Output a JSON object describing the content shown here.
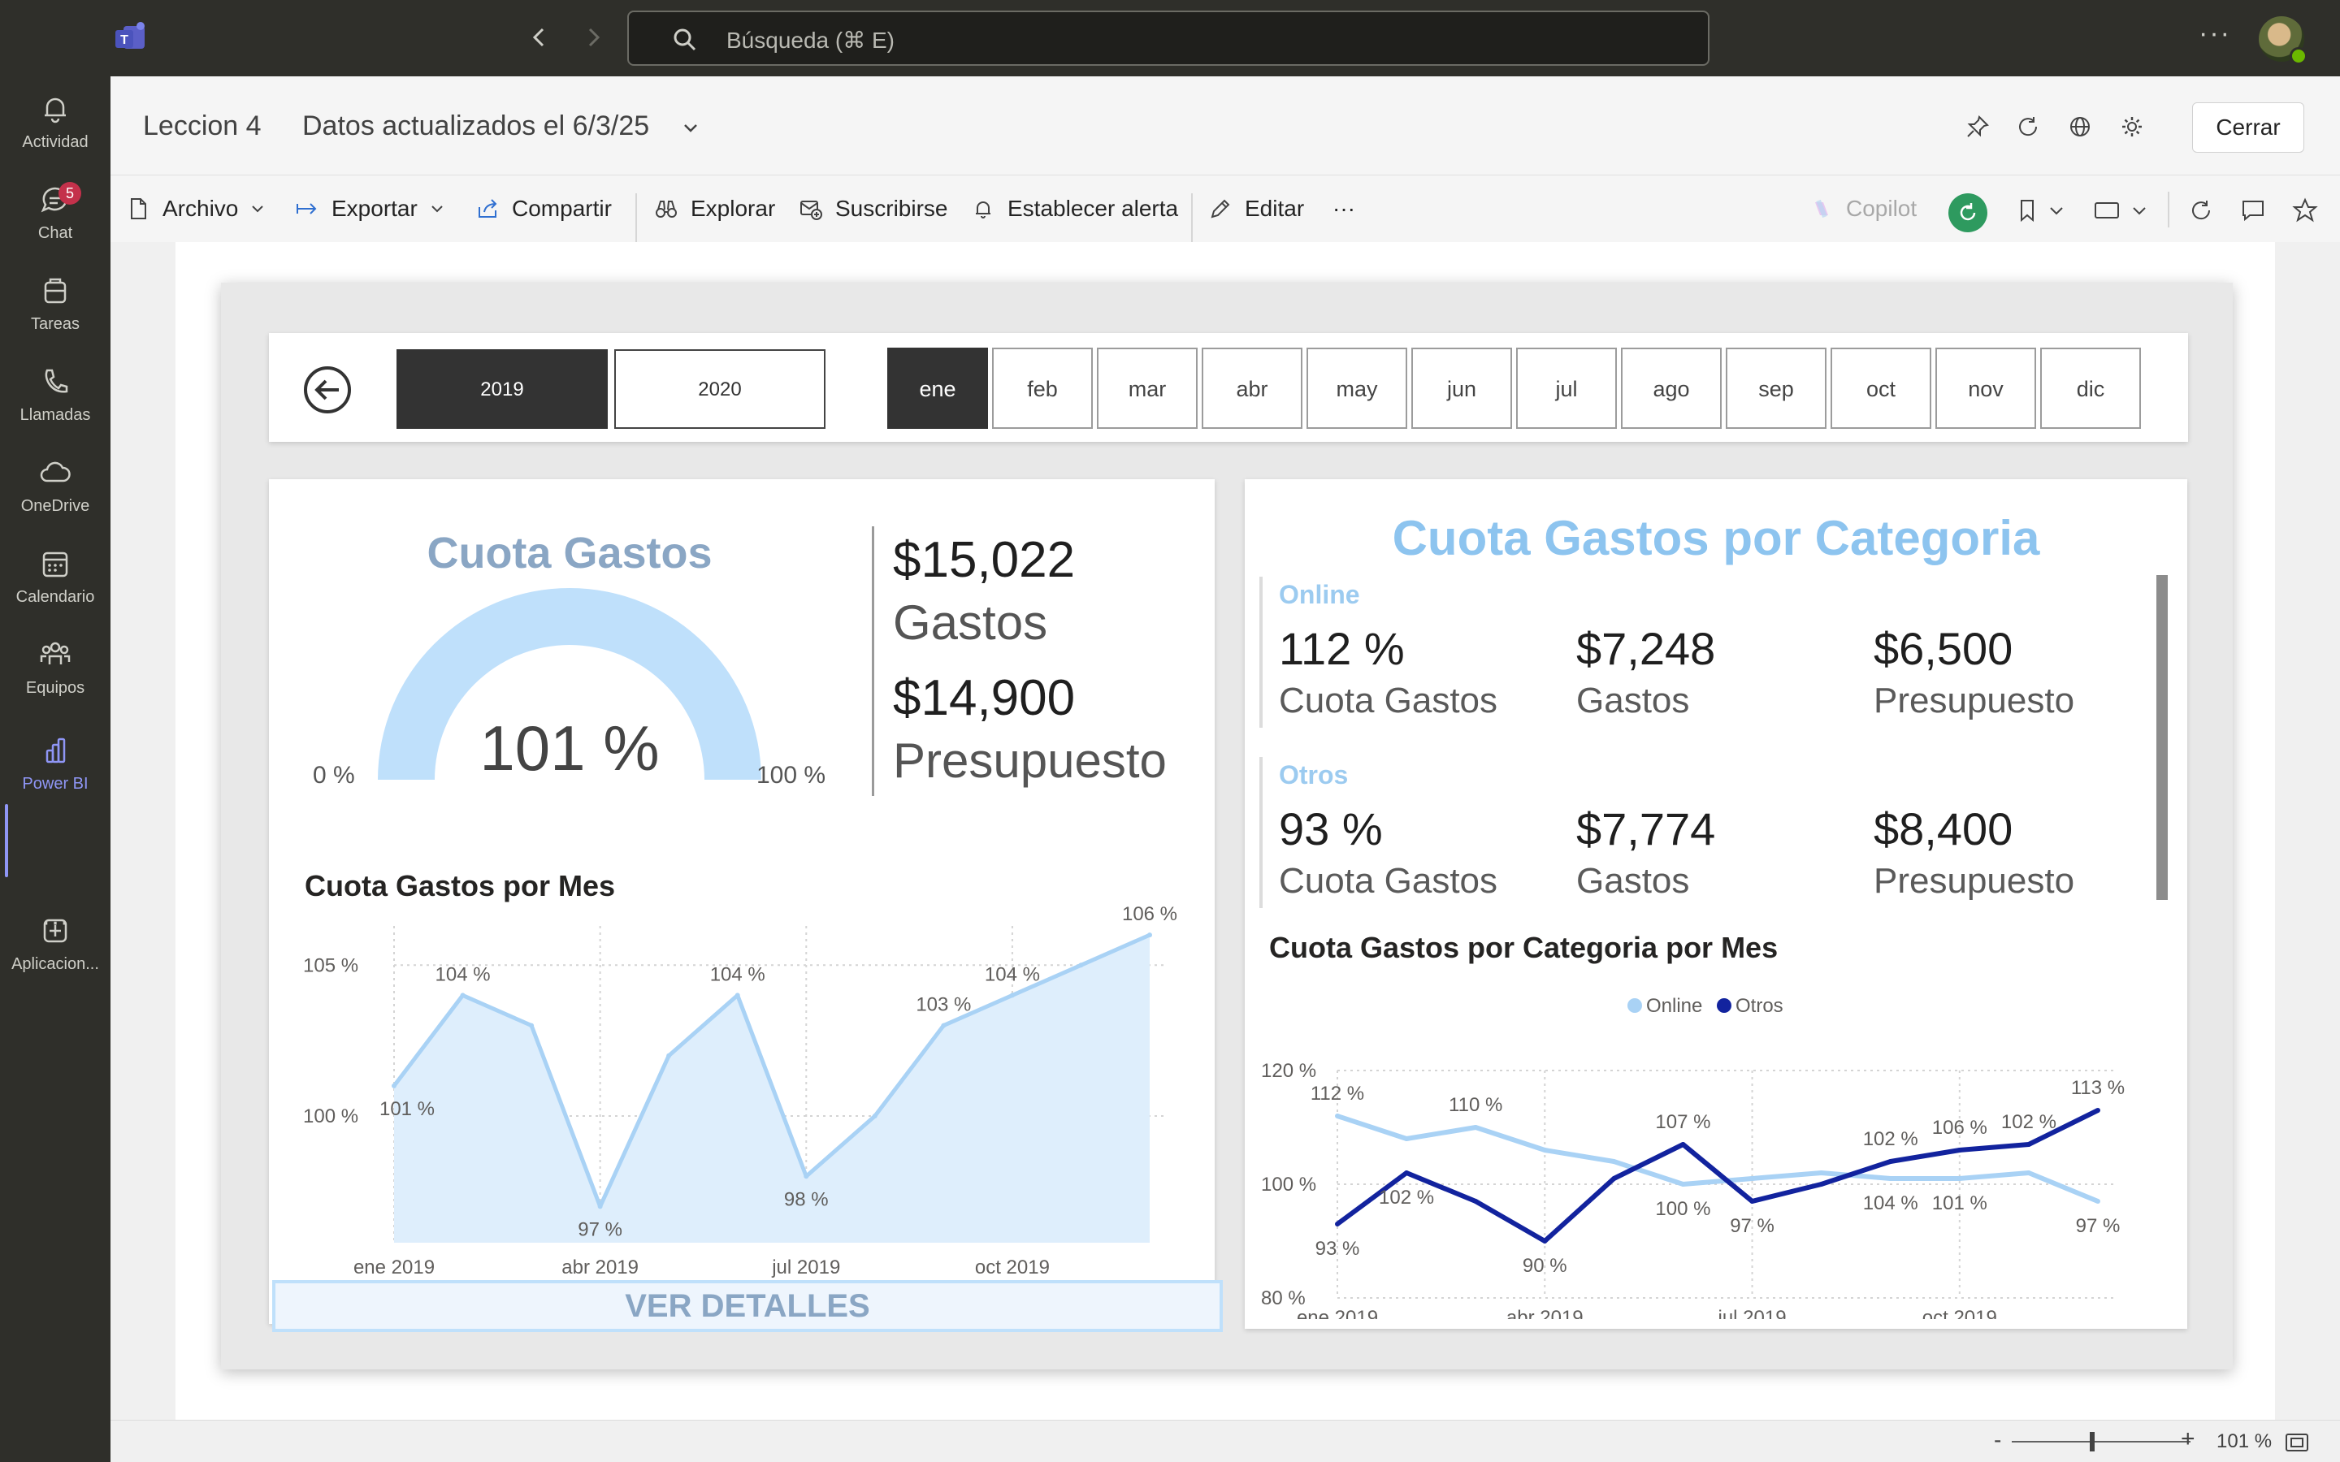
{
  "titlebar": {
    "search_placeholder": "Búsqueda (⌘ E)",
    "more": "···"
  },
  "rail": {
    "items": [
      {
        "label": "Actividad",
        "icon": "bell-icon"
      },
      {
        "label": "Chat",
        "icon": "chat-icon",
        "badge": "5"
      },
      {
        "label": "Tareas",
        "icon": "tasks-icon"
      },
      {
        "label": "Llamadas",
        "icon": "phone-icon"
      },
      {
        "label": "OneDrive",
        "icon": "cloud-icon"
      },
      {
        "label": "Calendario",
        "icon": "calendar-icon"
      },
      {
        "label": "Equipos",
        "icon": "teams-icon"
      },
      {
        "label": "Power BI",
        "icon": "powerbi-icon",
        "active": true
      },
      {
        "label": "Aplicacion...",
        "icon": "add-apps-icon"
      }
    ],
    "more": "···"
  },
  "report_header": {
    "name": "Leccion 4",
    "updated": "Datos actualizados el 6/3/25",
    "close": "Cerrar"
  },
  "toolbar": {
    "archivo": "Archivo",
    "exportar": "Exportar",
    "compartir": "Compartir",
    "explorar": "Explorar",
    "suscribirse": "Suscribirse",
    "alerta": "Establecer alerta",
    "editar": "Editar",
    "more": "···",
    "copilot": "Copilot"
  },
  "status": {
    "zoom_minus": "-",
    "zoom_plus": "+",
    "zoom": "101 %",
    "zoom_fraction": 0.45
  },
  "slicer": {
    "years": [
      "2019",
      "2020"
    ],
    "selected_year": "2019",
    "months": [
      "ene",
      "feb",
      "mar",
      "abr",
      "may",
      "jun",
      "jul",
      "ago",
      "sep",
      "oct",
      "nov",
      "dic"
    ],
    "selected_month": "ene"
  },
  "gauge": {
    "title": "Cuota Gastos",
    "value_label": "101 %",
    "value": 101,
    "min_label": "0 %",
    "max_label": "100 %",
    "fill_color": "#bfe0fb"
  },
  "kpis": {
    "gastos_value": "$15,022",
    "gastos_label": "Gastos",
    "presupuesto_value": "$14,900",
    "presupuesto_label": "Presupuesto"
  },
  "monthly": {
    "title": "Cuota Gastos por Mes",
    "details_button": "VER DETALLES"
  },
  "categories": {
    "title": "Cuota Gastos por Categoria",
    "items": [
      {
        "name": "Online",
        "cuota": "112 %",
        "cuota_label": "Cuota Gastos",
        "gastos": "$7,248",
        "gastos_label": "Gastos",
        "presupuesto": "$6,500",
        "presupuesto_label": "Presupuesto"
      },
      {
        "name": "Otros",
        "cuota": "93 %",
        "cuota_label": "Cuota Gastos",
        "gastos": "$7,774",
        "gastos_label": "Gastos",
        "presupuesto": "$8,400",
        "presupuesto_label": "Presupuesto"
      }
    ],
    "chart_title": "Cuota Gastos por Categoria por Mes"
  },
  "chart_data": [
    {
      "type": "area",
      "title": "Cuota Gastos por Mes",
      "x": [
        "ene 2019",
        "feb 2019",
        "mar 2019",
        "abr 2019",
        "may 2019",
        "jun 2019",
        "jul 2019",
        "ago 2019",
        "sep 2019",
        "oct 2019",
        "nov 2019",
        "dic 2019"
      ],
      "xticks": [
        "ene 2019",
        "abr 2019",
        "jul 2019",
        "oct 2019"
      ],
      "yticks": [
        "100 %",
        "105 %"
      ],
      "ylim": [
        95.8,
        106.3
      ],
      "values": [
        101,
        104,
        103,
        97,
        102,
        104,
        98,
        100,
        103,
        104,
        105,
        106
      ],
      "labels": [
        "101 %",
        "104 %",
        "",
        "97 %",
        "",
        "104 %",
        "98 %",
        "",
        "103 %",
        "104 %",
        "",
        "106 %"
      ],
      "color": "#a9d2f5",
      "fill": "#deeefc"
    },
    {
      "type": "line",
      "title": "Cuota Gastos por Categoria por Mes",
      "x": [
        "ene 2019",
        "feb 2019",
        "mar 2019",
        "abr 2019",
        "may 2019",
        "jun 2019",
        "jul 2019",
        "ago 2019",
        "sep 2019",
        "oct 2019",
        "nov 2019",
        "dic 2019"
      ],
      "xticks": [
        "ene 2019",
        "abr 2019",
        "jul 2019",
        "oct 2019"
      ],
      "yticks": [
        "80 %",
        "100 %",
        "120 %"
      ],
      "ylim": [
        80,
        120
      ],
      "legend": "top-center",
      "series": [
        {
          "name": "Online",
          "color": "#a9d2f5",
          "values": [
            112,
            108,
            110,
            106,
            104,
            100,
            101,
            102,
            101,
            101,
            102,
            97
          ],
          "labels": [
            "112 %",
            "",
            "110 %",
            "",
            "",
            "100 %",
            "",
            "",
            "104 %",
            "101 %",
            "",
            "97 %"
          ]
        },
        {
          "name": "Otros",
          "color": "#12239e",
          "values": [
            93,
            102,
            97,
            90,
            101,
            107,
            97,
            100,
            104,
            106,
            107,
            113
          ],
          "labels": [
            "93 %",
            "102 %",
            "",
            "90 %",
            "",
            "107 %",
            "97 %",
            "",
            "102 %",
            "106 %",
            "102 %",
            "113 %"
          ]
        }
      ]
    }
  ]
}
